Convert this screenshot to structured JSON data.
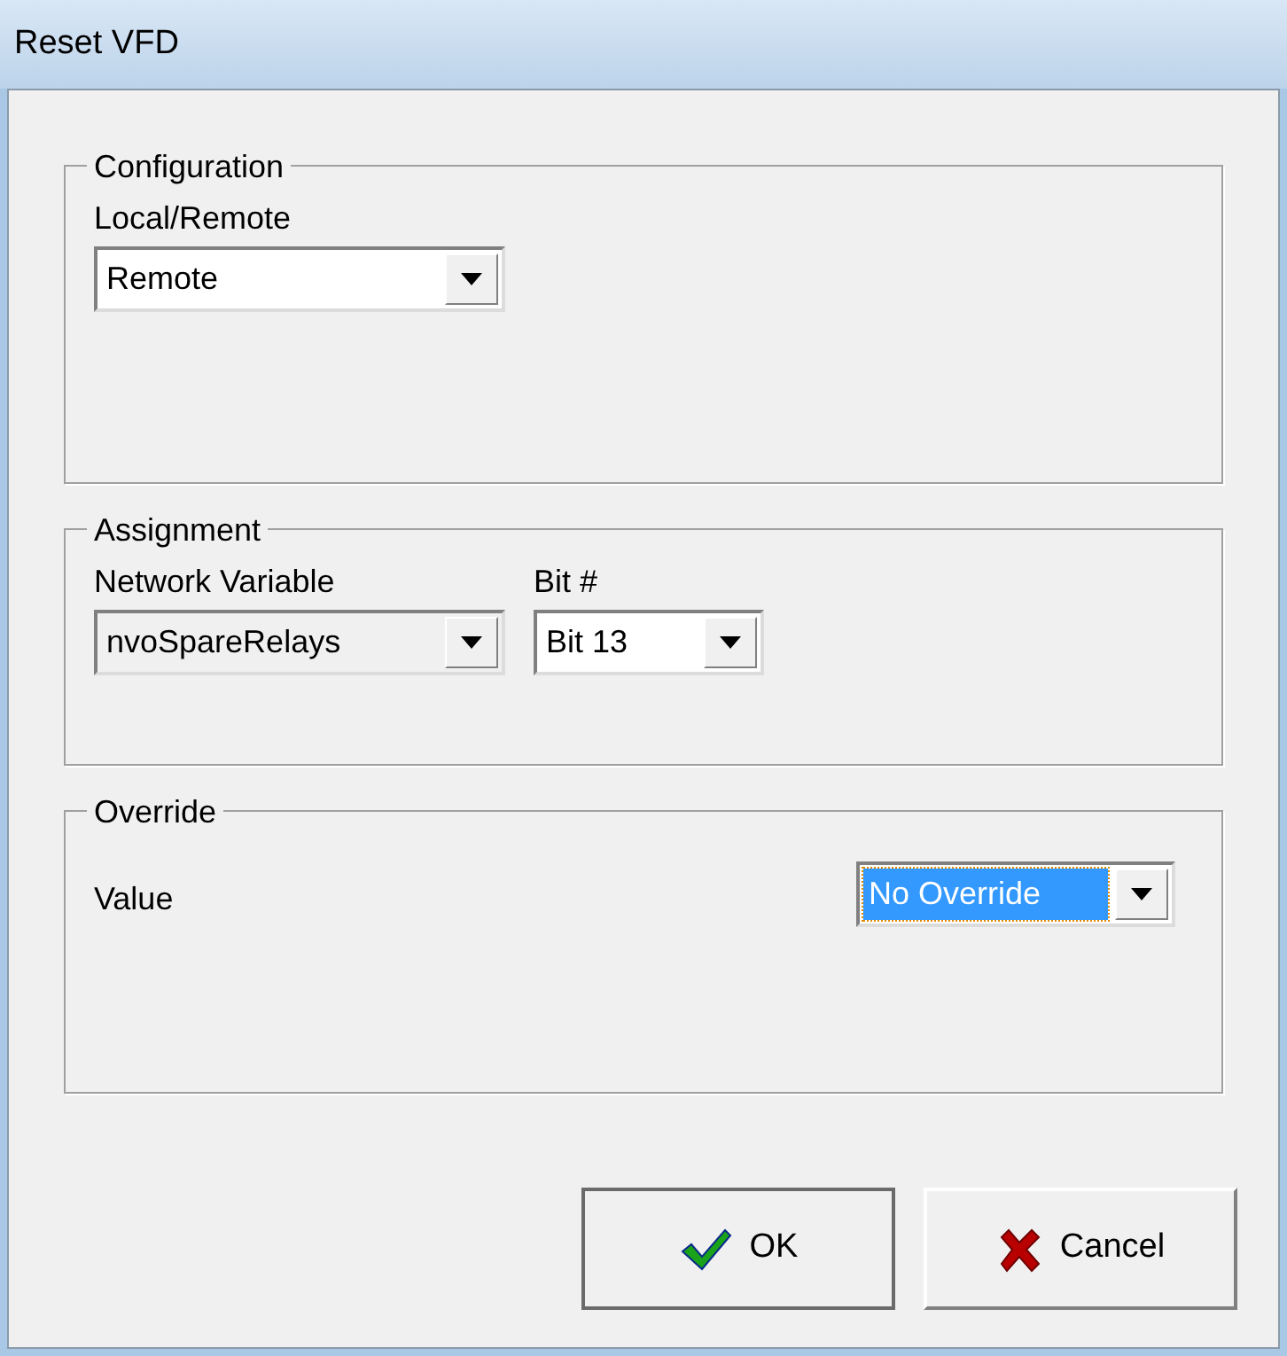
{
  "window": {
    "title": "Reset VFD"
  },
  "groups": [
    {
      "title": "Configuration",
      "fields": [
        {
          "label": "Local/Remote",
          "value": "Remote",
          "disabled": false,
          "focused": false
        }
      ]
    },
    {
      "title": "Assignment",
      "fields": [
        {
          "label": "Network Variable",
          "value": "nvoSpareRelays",
          "disabled": true,
          "focused": false
        },
        {
          "label": "Bit #",
          "value": "Bit 13",
          "disabled": false,
          "focused": false
        }
      ]
    },
    {
      "title": "Override",
      "fields": [
        {
          "label": "Value",
          "value": "No Override",
          "disabled": false,
          "focused": true
        }
      ]
    }
  ],
  "buttons": [
    {
      "label": "OK",
      "kind": "ok"
    },
    {
      "label": "Cancel",
      "kind": "cancel"
    }
  ]
}
